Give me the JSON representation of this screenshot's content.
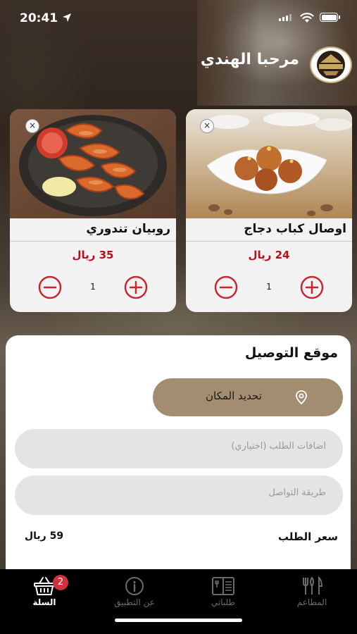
{
  "status_bar": {
    "time": "20:41"
  },
  "header": {
    "greeting": "مرحبا الهندي"
  },
  "cart_items": [
    {
      "name": "روبيان تندوري",
      "price": "35 ريال",
      "quantity": "1"
    },
    {
      "name": "اوصال كباب دجاج",
      "price": "24 ريال",
      "quantity": "1"
    }
  ],
  "delivery": {
    "title": "موقع التوصيل",
    "locate_label": "تحديد المكان",
    "additions_placeholder": "اضافات الطلب (اختياري)",
    "contact_placeholder": "طريقة التواصل",
    "order_price_label": "سعر الطلب",
    "order_price_value": "59 ريال"
  },
  "tabbar": {
    "cart": {
      "label": "السلة",
      "badge": "2"
    },
    "about": {
      "label": "عن التطبيق"
    },
    "orders": {
      "label": "طلباتي"
    },
    "restaurants": {
      "label": "المطاعم"
    }
  },
  "colors": {
    "accent": "#a28d70",
    "price": "#b4101c",
    "stepper": "#c8262f",
    "badge": "#d0313d"
  }
}
